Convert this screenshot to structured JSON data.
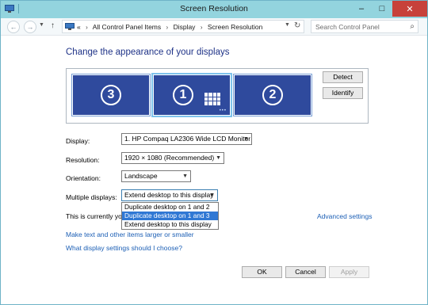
{
  "window": {
    "title": "Screen Resolution"
  },
  "address": {
    "path": [
      "All Control Panel Items",
      "Display",
      "Screen Resolution"
    ],
    "prefix": "«"
  },
  "search": {
    "placeholder": "Search Control Panel"
  },
  "heading": "Change the appearance of your displays",
  "monitors": [
    "3",
    "1",
    "2"
  ],
  "buttons": {
    "detect": "Detect",
    "identify": "Identify",
    "ok": "OK",
    "cancel": "Cancel",
    "apply": "Apply"
  },
  "fields": {
    "display": {
      "label": "Display:",
      "value": "1. HP Compaq LA2306 Wide LCD Monitor"
    },
    "resolution": {
      "label": "Resolution:",
      "value": "1920 × 1080 (Recommended)"
    },
    "orientation": {
      "label": "Orientation:",
      "value": "Landscape"
    },
    "multiple": {
      "label": "Multiple displays:",
      "value": "Extend desktop to this display"
    }
  },
  "multiple_options": [
    "Duplicate desktop on 1 and 2",
    "Duplicate desktop on 1 and 3",
    "Extend desktop to this display"
  ],
  "status_text": "This is currently you",
  "links": {
    "advanced": "Advanced settings",
    "text_size": "Make text and other items larger or smaller",
    "help": "What display settings should I choose?"
  },
  "icons": {
    "back": "back-arrow-icon",
    "forward": "forward-arrow-icon",
    "up": "up-arrow-icon",
    "refresh": "refresh-icon",
    "search": "search-icon"
  },
  "colors": {
    "titlebar": "#93d4de",
    "monitor": "#2f4a9d",
    "link": "#1c5fb5",
    "highlight": "#3078d4",
    "heading": "#1e3287"
  }
}
